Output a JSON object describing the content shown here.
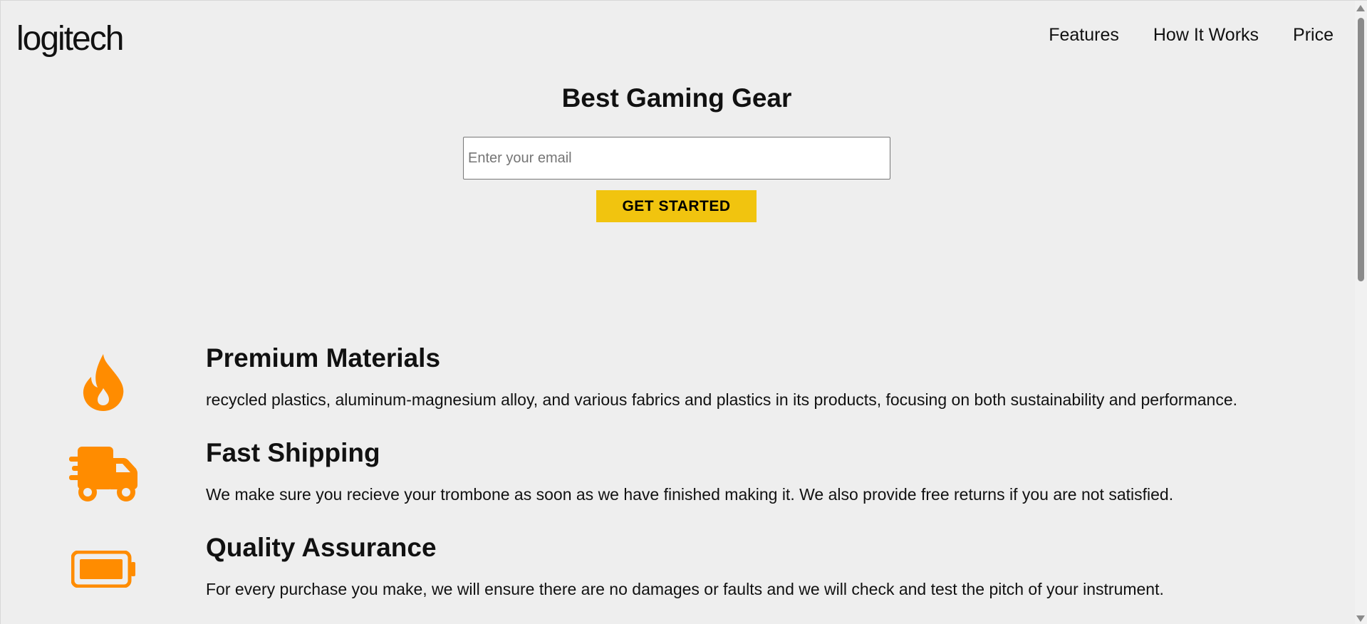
{
  "header": {
    "logo_text": "logitech",
    "nav": [
      {
        "label": "Features"
      },
      {
        "label": "How It Works"
      },
      {
        "label": "Price"
      }
    ]
  },
  "hero": {
    "title": "Best Gaming Gear",
    "email_placeholder": "Enter your email",
    "email_value": "",
    "cta_label": "GET STARTED"
  },
  "features": [
    {
      "icon": "fire-icon",
      "title": "Premium Materials",
      "text": "recycled plastics, aluminum-magnesium alloy, and various fabrics and plastics in its products, focusing on both sustainability and performance."
    },
    {
      "icon": "truck-fast-icon",
      "title": "Fast Shipping",
      "text": "We make sure you recieve your trombone as soon as we have finished making it. We also provide free returns if you are not satisfied."
    },
    {
      "icon": "battery-full-icon",
      "title": "Quality Assurance",
      "text": "For every purchase you make, we will ensure there are no damages or faults and we will check and test the pitch of your instrument."
    }
  ],
  "colors": {
    "background": "#eeeeee",
    "accent": "#f1c40f",
    "icon": "#ff8c00",
    "text": "#111111"
  }
}
